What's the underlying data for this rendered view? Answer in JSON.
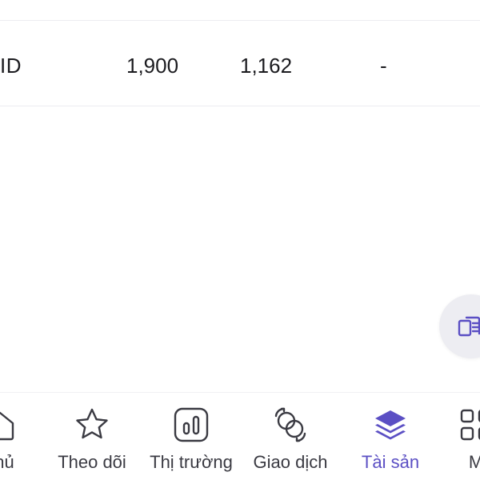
{
  "table": {
    "row": {
      "symbol": "ID",
      "col1": "1,900",
      "col2": "1,162",
      "col3": "-"
    }
  },
  "fab": {
    "icon": "swap-screen-icon"
  },
  "tabbar": {
    "tabs": [
      {
        "label": "chủ",
        "icon": "home-icon",
        "active": false
      },
      {
        "label": "Theo dõi",
        "icon": "star-icon",
        "active": false
      },
      {
        "label": "Thị trường",
        "icon": "bar-chart-icon",
        "active": false
      },
      {
        "label": "Giao dịch",
        "icon": "exchange-icon",
        "active": false
      },
      {
        "label": "Tài sản",
        "icon": "layers-icon",
        "active": true
      },
      {
        "label": "M",
        "icon": "grid-icon",
        "active": false
      }
    ]
  },
  "colors": {
    "accent": "#5b4fc4",
    "text": "#1b1b1f",
    "tab_text": "#3a3a42",
    "divider": "#ececf0",
    "fab_bg": "#ededf2"
  }
}
